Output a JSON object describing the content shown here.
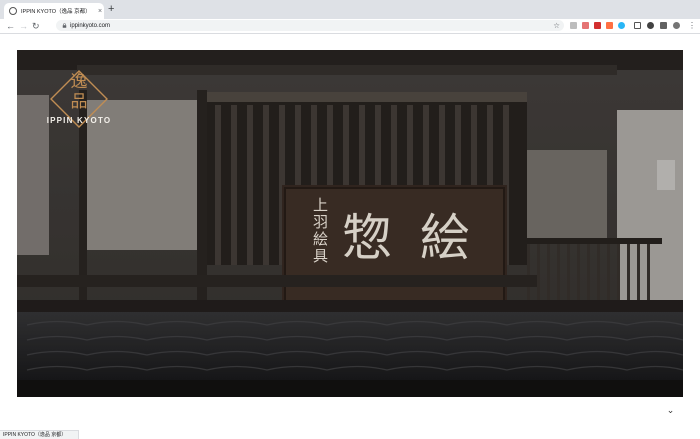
{
  "browser": {
    "tab_title": "IPPIN KYOTO（逸品 京都）",
    "tab_close": "×",
    "new_tab": "+",
    "url": "ippinkyoto.com",
    "back": "←",
    "forward": "→",
    "reload": "↻",
    "bookmark_star": "☆",
    "menu": "⋮",
    "status_text": "IPPIN KYOTO（逸品 京都）"
  },
  "hero": {
    "logo_kanji_top": "逸",
    "logo_kanji_bottom": "品",
    "brand_name": "IPPIN KYOTO",
    "sign_small": "上羽絵具",
    "sign_large": "惣 絵",
    "scroll_down": "⌄"
  },
  "colors": {
    "logo_gold": "#c08d53",
    "chrome": "#dee1e6"
  }
}
